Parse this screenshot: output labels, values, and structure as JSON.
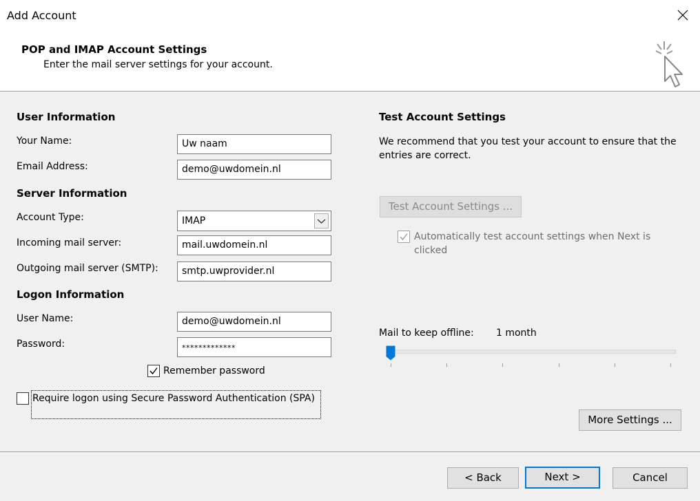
{
  "window": {
    "title": "Add Account"
  },
  "header": {
    "title": "POP and IMAP Account Settings",
    "subtitle": "Enter the mail server settings for your account."
  },
  "user_info": {
    "heading": "User Information",
    "name_label": "Your Name:",
    "name_value": "Uw naam",
    "email_label": "Email Address:",
    "email_value": "demo@uwdomein.nl"
  },
  "server_info": {
    "heading": "Server Information",
    "account_type_label": "Account Type:",
    "account_type_value": "IMAP",
    "incoming_label": "Incoming mail server:",
    "incoming_value": "mail.uwdomein.nl",
    "outgoing_label": "Outgoing mail server (SMTP):",
    "outgoing_value": "smtp.uwprovider.nl"
  },
  "logon_info": {
    "heading": "Logon Information",
    "username_label": "User Name:",
    "username_value": "demo@uwdomein.nl",
    "password_label": "Password:",
    "password_value": "*************",
    "remember_label": "Remember password",
    "remember_checked": true,
    "spa_label": "Require logon using Secure Password Authentication (SPA)",
    "spa_checked": false
  },
  "test_settings": {
    "heading": "Test Account Settings",
    "description": "We recommend that you test your account to ensure that the entries are correct.",
    "test_button": "Test Account Settings ...",
    "auto_test_label": "Automatically test account settings when Next is clicked",
    "auto_test_checked": true
  },
  "offline": {
    "label": "Mail to keep offline:",
    "value": "1 month",
    "slider_position": 0
  },
  "buttons": {
    "more_settings": "More Settings ...",
    "back": "< Back",
    "next": "Next >",
    "cancel": "Cancel"
  },
  "colors": {
    "accent": "#0078d7",
    "thumb": "#0078d7"
  },
  "icons": {
    "close": "close-icon",
    "wizard": "magic-cursor-icon"
  }
}
